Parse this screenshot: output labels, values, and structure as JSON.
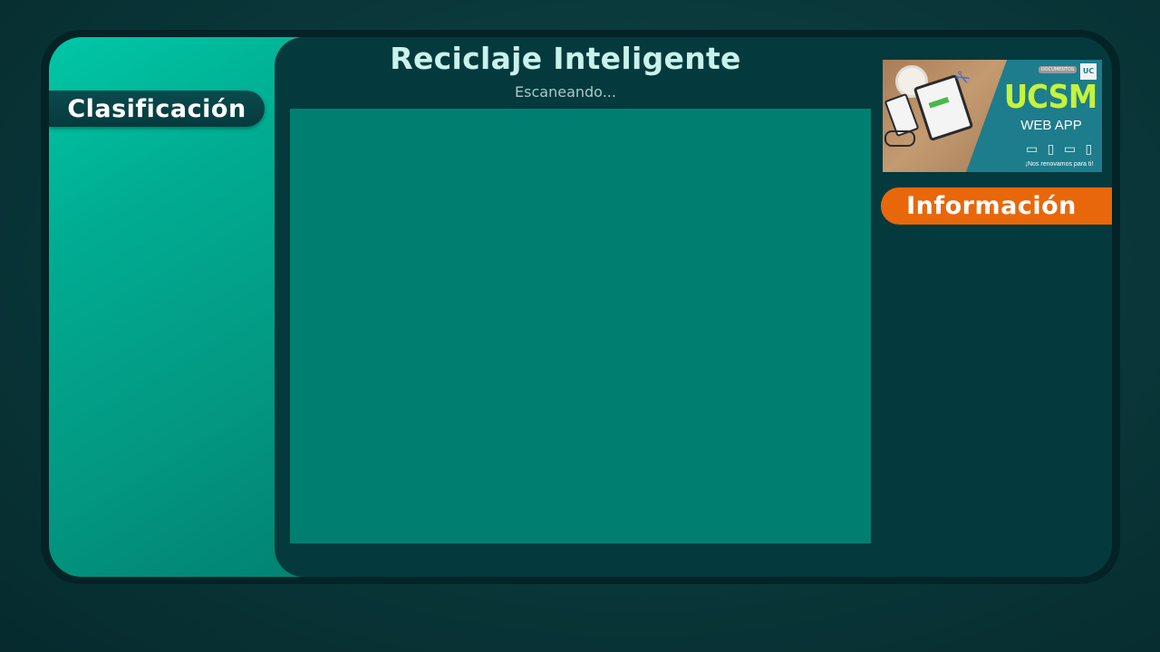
{
  "app": {
    "title": "Reciclaje Inteligente",
    "status": "Escaneando..."
  },
  "sidebar": {
    "classification_label": "Clasificación"
  },
  "info_panel": {
    "label": "Información"
  },
  "banner": {
    "brand": "UCSM",
    "subbrand": "WEB APP",
    "tagline": "¡Nos renovamos para ti!",
    "top_label": "DOCUMENTOS",
    "logo_text": "UC SM"
  },
  "colors": {
    "background": "#0a3a3c",
    "frame": "#042326",
    "left_panel_accent": "#00c7a6",
    "center_panel": "#04393d",
    "scan_area": "#007f70",
    "title_text": "#c9f2ea",
    "info_button": "#e8670a",
    "brand_green": "#c6f23a",
    "banner_teal": "#1d7d8c"
  },
  "icons": {
    "devices": "laptop-phone-monitor-tablet-icons"
  }
}
